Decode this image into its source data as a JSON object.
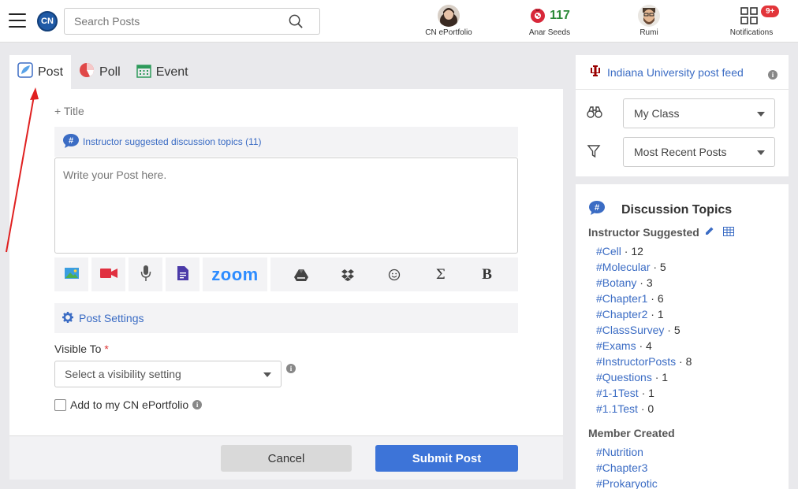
{
  "topbar": {
    "logo": "CN",
    "search_placeholder": "Search Posts",
    "eportfolio_label": "CN ePortfolio",
    "seed_count": "117",
    "seeds_label": "Anar Seeds",
    "rumi_label": "Rumi",
    "notif_badge": "9+",
    "notif_label": "Notifications"
  },
  "tabs": [
    {
      "label": "Post"
    },
    {
      "label": "Poll"
    },
    {
      "label": "Event"
    }
  ],
  "composer": {
    "title_link": "+ Title",
    "suggested_topics": "Instructor suggested discussion topics (11)",
    "post_placeholder": "Write your Post here.",
    "zoom_label": "zoom",
    "sigma": "Σ",
    "bold": "B",
    "post_settings": "Post Settings",
    "visible_to": "Visible To",
    "required_mark": "*",
    "visibility_select": "Select a visibility setting",
    "add_eportfolio": "Add to my CN ePortfolio",
    "cancel": "Cancel",
    "submit": "Submit Post"
  },
  "feed": {
    "title": "Indiana University post feed",
    "class_select": "My Class",
    "sort_select": "Most Recent Posts"
  },
  "topics": {
    "title": "Discussion Topics",
    "instructor_heading": "Instructor Suggested",
    "instructor_tags": [
      {
        "tag": "#Cell",
        "count": " · 12"
      },
      {
        "tag": "#Molecular",
        "count": " · 5"
      },
      {
        "tag": "#Botany",
        "count": " · 3"
      },
      {
        "tag": "#Chapter1",
        "count": " · 6"
      },
      {
        "tag": "#Chapter2",
        "count": " · 1"
      },
      {
        "tag": "#ClassSurvey",
        "count": " · 5"
      },
      {
        "tag": "#Exams",
        "count": " · 4"
      },
      {
        "tag": "#InstructorPosts",
        "count": " · 8"
      },
      {
        "tag": "#Questions",
        "count": " · 1"
      },
      {
        "tag": "#1-1Test",
        "count": " · 1"
      },
      {
        "tag": "#1.1Test",
        "count": " · 0"
      }
    ],
    "member_heading": "Member Created",
    "member_tags": [
      {
        "tag": "#Nutrition"
      },
      {
        "tag": "#Chapter3"
      },
      {
        "tag": "#Prokaryotic"
      }
    ]
  },
  "colors": {
    "accent": "#3b6cc4",
    "submit": "#3d74d8",
    "seeds": "#2e8b3a",
    "badge": "#e2353a"
  }
}
